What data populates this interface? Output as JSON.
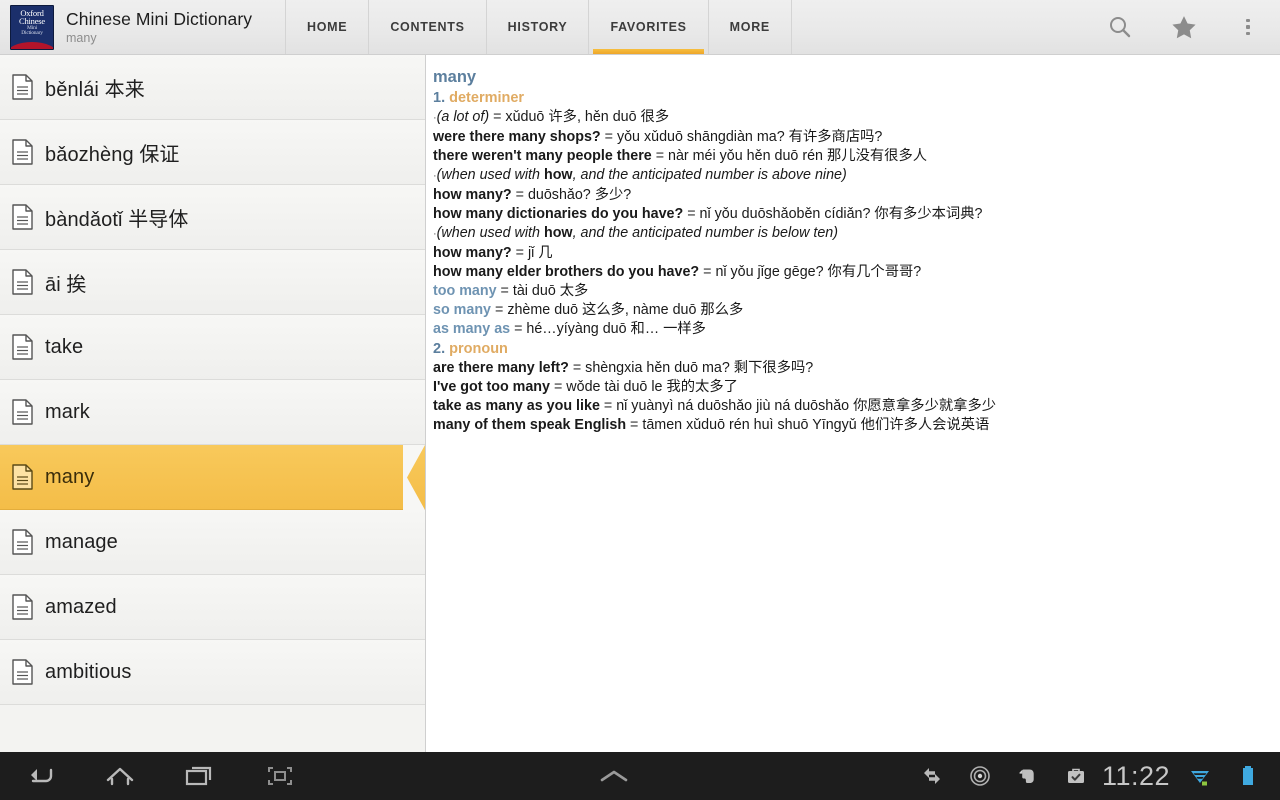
{
  "app": {
    "title": "Chinese Mini Dictionary",
    "subtitle": "many",
    "logo": {
      "line1": "Oxford",
      "line2": "Chinese",
      "line3": "Mini",
      "line4": "Dictionary"
    },
    "accent_color": "#f4bd48",
    "headword_color": "#5c7f9e",
    "pos_color": "#e0ab63"
  },
  "tabs": [
    {
      "label": "HOME",
      "active": false
    },
    {
      "label": "CONTENTS",
      "active": false
    },
    {
      "label": "HISTORY",
      "active": false
    },
    {
      "label": "FAVORITES",
      "active": true
    },
    {
      "label": "MORE",
      "active": false
    }
  ],
  "actionbar_icons": [
    {
      "name": "search-icon",
      "label": "Search"
    },
    {
      "name": "star-icon",
      "label": "Favorites"
    },
    {
      "name": "overflow-menu-icon",
      "label": "More options"
    }
  ],
  "sidebar": {
    "items": [
      {
        "label": "běnlái 本来",
        "selected": false
      },
      {
        "label": "bǎozhèng 保证",
        "selected": false
      },
      {
        "label": "bàndǎotǐ 半导体",
        "selected": false
      },
      {
        "label": "āi 挨",
        "selected": false
      },
      {
        "label": "take",
        "selected": false
      },
      {
        "label": "mark",
        "selected": false
      },
      {
        "label": "many",
        "selected": true
      },
      {
        "label": "manage",
        "selected": false
      },
      {
        "label": "amazed",
        "selected": false
      },
      {
        "label": "ambitious",
        "selected": false
      }
    ]
  },
  "entry": {
    "headword": "many",
    "senses": [
      {
        "num": "1.",
        "pos": "determiner"
      },
      {
        "num": "2.",
        "pos": "pronoun"
      }
    ],
    "lines": [
      {
        "type": "gloss",
        "bullet": "·",
        "gloss": "(a lot of)",
        "eq": " = ",
        "trans": "xǔduō 许多, hěn duō 很多"
      },
      {
        "type": "example",
        "en": "were there many shops?",
        "eq": " = ",
        "trans": "yǒu xǔduō shāngdiàn ma? 有许多商店吗?"
      },
      {
        "type": "example",
        "en": "there weren't many people there",
        "eq": " = ",
        "trans": "nàr méi yǒu hěn duō rén 那儿没有很多人"
      },
      {
        "type": "note",
        "bullet": "·",
        "pre": "(when used with ",
        "bold": "how",
        "post": ", and the anticipated number is above nine)"
      },
      {
        "type": "example",
        "en": "how many?",
        "eq": " = ",
        "trans": "duōshǎo? 多少?"
      },
      {
        "type": "example",
        "en": "how many dictionaries do you have?",
        "eq": " = ",
        "trans": "nǐ yǒu duōshǎoběn cídiǎn? 你有多少本词典?"
      },
      {
        "type": "note",
        "bullet": "·",
        "pre": "(when used with ",
        "bold": "how",
        "post": ", and the anticipated number is below ten)"
      },
      {
        "type": "example",
        "en": "how many?",
        "eq": " = ",
        "trans": "jǐ 几"
      },
      {
        "type": "example",
        "en": "how many elder brothers do you have?",
        "eq": " = ",
        "trans": "nǐ yǒu jǐge gēge? 你有几个哥哥?"
      },
      {
        "type": "phrase",
        "en": "too many",
        "eq": " = ",
        "trans": "tài duō 太多"
      },
      {
        "type": "phrase",
        "en": "so many",
        "eq": " = ",
        "trans": "zhème duō 这么多, nàme duō 那么多"
      },
      {
        "type": "phrase",
        "en": "as many as",
        "eq": " = ",
        "trans": "hé…yíyàng duō 和… 一样多"
      },
      {
        "type": "sense",
        "num": "2.",
        "pos": "pronoun"
      },
      {
        "type": "example",
        "en": "are there many left?",
        "eq": " = ",
        "trans": "shèngxia hěn duō ma? 剩下很多吗?"
      },
      {
        "type": "example",
        "en": "I've got too many",
        "eq": " = ",
        "trans": "wǒde tài duō le 我的太多了"
      },
      {
        "type": "example",
        "en": "take as many as you like",
        "eq": " = ",
        "trans": "nǐ yuànyì ná duōshǎo jiù ná duōshǎo 你愿意拿多少就拿多少"
      },
      {
        "type": "example",
        "en": "many of them speak English",
        "eq": " = ",
        "trans": "tāmen xǔduō rén huì shuō Yīngyǔ 他们许多人会说英语"
      }
    ]
  },
  "systembar": {
    "nav": [
      {
        "name": "back-button",
        "label": "Back"
      },
      {
        "name": "home-button",
        "label": "Home"
      },
      {
        "name": "recents-button",
        "label": "Recent apps"
      },
      {
        "name": "screenshot-button",
        "label": "Screenshot"
      }
    ],
    "expand": {
      "name": "expand-chevron-icon",
      "label": "Expand"
    },
    "status": [
      {
        "name": "sync-icon",
        "label": "Sync"
      },
      {
        "name": "target-icon",
        "label": "Location"
      },
      {
        "name": "evernote-icon",
        "label": "Evernote"
      },
      {
        "name": "task-icon",
        "label": "Tasks"
      }
    ],
    "clock": "11:22",
    "wifi": {
      "name": "wifi-icon",
      "label": "Wi-Fi"
    },
    "battery": {
      "name": "battery-icon",
      "label": "Battery"
    }
  }
}
